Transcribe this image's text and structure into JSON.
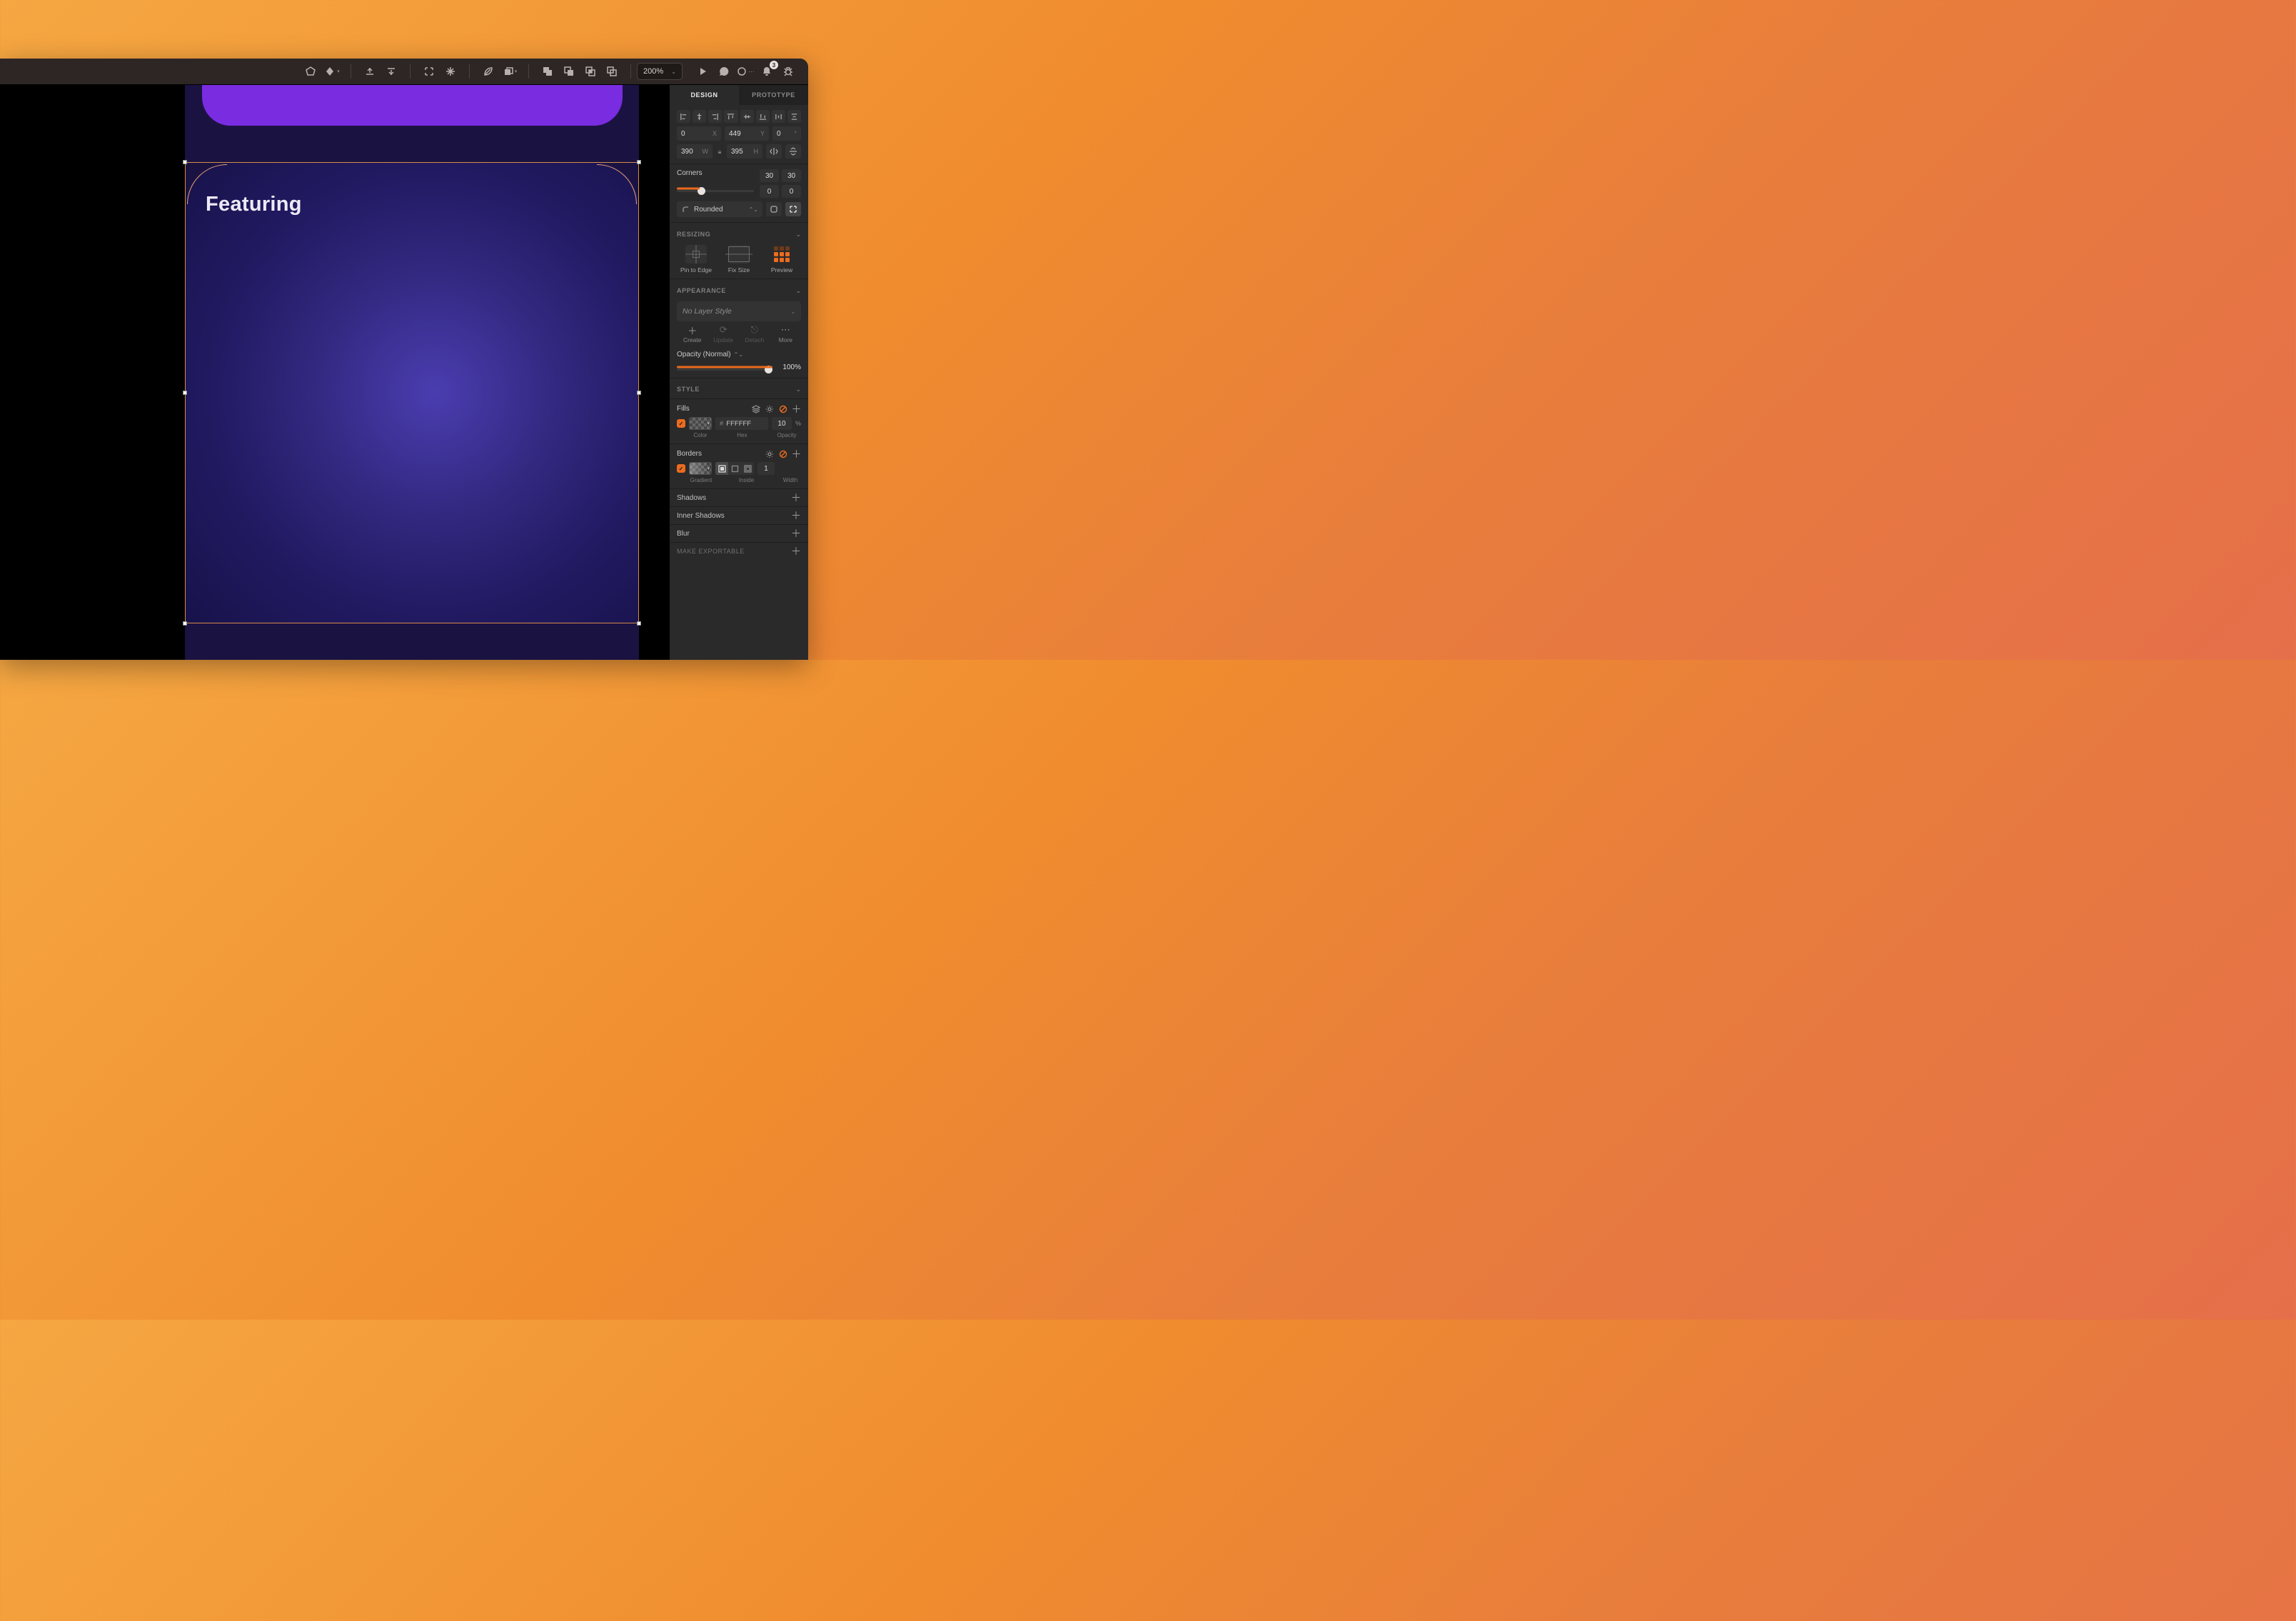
{
  "toolbar": {
    "zoom": "200%",
    "notification_count": "3"
  },
  "canvas": {
    "element_title": "Featuring"
  },
  "inspector": {
    "tabs": {
      "design": "DESIGN",
      "prototype": "PROTOTYPE"
    },
    "position": {
      "x": "0",
      "x_lab": "X",
      "y": "449",
      "y_lab": "Y",
      "r": "0",
      "r_lab": "°"
    },
    "size": {
      "w": "390",
      "w_lab": "W",
      "h": "395",
      "h_lab": "H"
    },
    "corners": {
      "label": "Corners",
      "tl": "30",
      "tr": "30",
      "bl": "0",
      "br": "0",
      "style": "Rounded"
    },
    "resizing": {
      "header": "RESIZING",
      "pin": "Pin to Edge",
      "fix": "Fix Size",
      "preview": "Preview"
    },
    "appearance": {
      "header": "APPEARANCE",
      "layer_style": "No Layer Style",
      "create": "Create",
      "update": "Update",
      "detach": "Detach",
      "more": "More",
      "opacity_label": "Opacity (Normal)",
      "opacity_value": "100%"
    },
    "style": {
      "header": "STYLE"
    },
    "fills": {
      "label": "Fills",
      "hex_prefix": "#",
      "hex": "FFFFFF",
      "opacity": "10",
      "pct": "%",
      "sub_color": "Color",
      "sub_hex": "Hex",
      "sub_op": "Opacity"
    },
    "borders": {
      "label": "Borders",
      "width": "1",
      "sub_grad": "Gradient",
      "sub_inside": "Inside",
      "sub_width": "Width"
    },
    "shadows": "Shadows",
    "inner_shadows": "Inner Shadows",
    "blur": "Blur",
    "exportable": "MAKE EXPORTABLE"
  }
}
